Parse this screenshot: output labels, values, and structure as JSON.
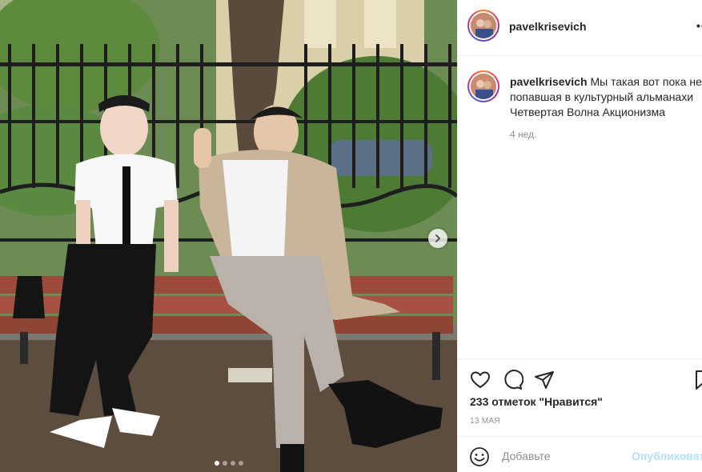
{
  "post": {
    "username": "pavelkrisevich",
    "more_label": "•••",
    "caption_user": "pavelkrisevich",
    "caption_lines": [
      "Мы такая вот пока не",
      "попавшая в культурный альманахи",
      "Четвертая Волна Акционизма"
    ],
    "time_ago": "4 нед.",
    "likes": "233 отметок \"Нравится\"",
    "date": "13 МАЯ"
  },
  "comment_box": {
    "placeholder": "Добавьте",
    "post_label": "Опубликовать"
  },
  "carousel": {
    "slide_count": 4,
    "active_index": 0
  },
  "icons": {
    "like": "heart-icon",
    "comment": "comment-icon",
    "share": "paper-plane-icon",
    "save": "bookmark-icon",
    "next": "chevron-right-icon",
    "emoji": "smiley-icon"
  },
  "colors": {
    "post_button": "#b2dffc",
    "muted_text": "#8e8e8e",
    "divider": "#efefef"
  }
}
